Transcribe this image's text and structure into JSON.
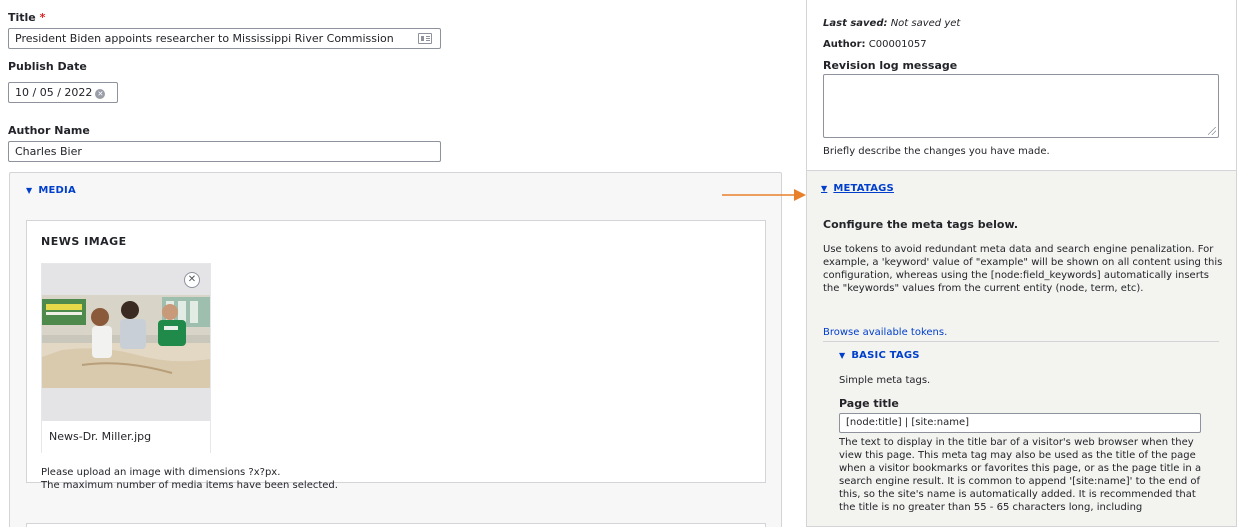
{
  "form": {
    "title_label": "Title",
    "required_mark": "*",
    "title_value": "President Biden appoints researcher to Mississippi River Commission",
    "publish_date_label": "Publish Date",
    "publish_date_value": "10 / 05 / 2022",
    "author_name_label": "Author Name",
    "author_name_value": "Charles Bier"
  },
  "media": {
    "section_label": "MEDIA",
    "news_image_heading": "NEWS IMAGE",
    "file_name": "News-Dr. Miller.jpg",
    "help_dimensions": "Please upload an image with dimensions ?x?px.",
    "help_max": "The maximum number of media items have been selected."
  },
  "sidebar": {
    "last_saved_label": "Last saved:",
    "last_saved_value": "Not saved yet",
    "author_label": "Author:",
    "author_value": "C00001057",
    "revision_label": "Revision log message",
    "revision_value": "",
    "revision_help": "Briefly describe the changes you have made.",
    "metatags_label": "METATAGS",
    "configure_heading": "Configure the meta tags below.",
    "tokens_desc": "Use tokens to avoid redundant meta data and search engine penalization. For example, a 'keyword' value of \"example\" will be shown on all content using this configuration, whereas using the [node:field_keywords] automatically inserts the \"keywords\" values from the current entity (node, term, etc).",
    "browse_tokens": "Browse available tokens.",
    "basic_tags_label": "BASIC TAGS",
    "basic_tags_desc": "Simple meta tags.",
    "page_title_label": "Page title",
    "page_title_value": "[node:title] | [site:name]",
    "page_title_help": "The text to display in the title bar of a visitor's web browser when they view this page. This meta tag may also be used as the title of the page when a visitor bookmarks or favorites this page, or as the page title in a search engine result. It is common to append '[site:name]' to the end of this, so the site's name is automatically added. It is recommended that the title is no greater than 55 - 65 characters long, including"
  },
  "colors": {
    "link": "#003ecc",
    "required": "#dc2323",
    "arrow": "#e8802a"
  }
}
